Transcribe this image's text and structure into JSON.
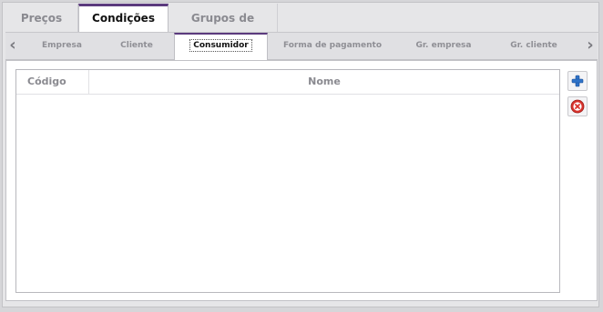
{
  "top_tabs": [
    {
      "label": "Preços",
      "active": false
    },
    {
      "label": "Condições",
      "active": true
    },
    {
      "label": "Grupos de usuário",
      "active": false
    }
  ],
  "sub_tabs": [
    {
      "label": "Empresa",
      "active": false
    },
    {
      "label": "Cliente",
      "active": false
    },
    {
      "label": "Consumidor",
      "active": true
    },
    {
      "label": "Forma de pagamento",
      "active": false
    },
    {
      "label": "Gr. empresa",
      "active": false
    },
    {
      "label": "Gr. cliente",
      "active": false
    }
  ],
  "grid": {
    "columns": [
      "Código",
      "Nome"
    ],
    "rows": []
  },
  "actions": {
    "add_icon": "plus-icon",
    "remove_icon": "remove-circle-icon"
  },
  "colors": {
    "accent": "#5b3a7e",
    "add_icon": "#2f73c9",
    "remove_icon": "#d9322c"
  }
}
